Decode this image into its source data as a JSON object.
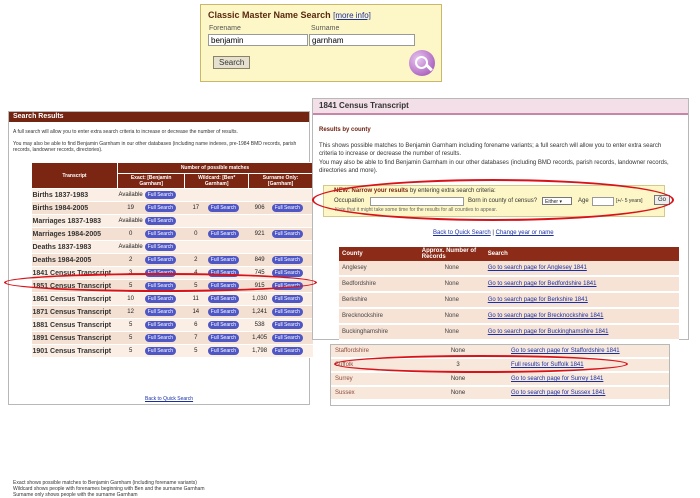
{
  "master_search": {
    "title": "Classic Master Name Search",
    "more_info": "[more info]",
    "forename_label": "Forename",
    "surname_label": "Surname",
    "forename_value": "benjamin",
    "surname_value": "garnham",
    "search_button": "Search"
  },
  "search_results": {
    "header": "Search Results",
    "intro": "A full search will allow you to enter extra search criteria to increase or decrease the number of results.",
    "also": "You may also be able to find Benjamin Garnham in our other databases (including name indexes, pre-1984 BMD records, parish records, landowner records, directories).",
    "col_transcript": "Transcript",
    "col_matches": "Number of possible matches",
    "col_exact": "Exact: [Benjamin Garnham]",
    "col_wildcard": "Wildcard: [Ben* Garnham]",
    "col_surname": "Surname Only: [Garnham]",
    "full_search": "Full Search",
    "rows": [
      {
        "name": "Births 1837-1983",
        "exact": "Available",
        "wild": "",
        "sur": ""
      },
      {
        "name": "Births 1984-2005",
        "exact": "19",
        "wild": "17",
        "sur": "906"
      },
      {
        "name": "Marriages 1837-1983",
        "exact": "Available",
        "wild": "",
        "sur": ""
      },
      {
        "name": "Marriages 1984-2005",
        "exact": "0",
        "wild": "0",
        "sur": "921"
      },
      {
        "name": "Deaths 1837-1983",
        "exact": "Available",
        "wild": "",
        "sur": ""
      },
      {
        "name": "Deaths 1984-2005",
        "exact": "2",
        "wild": "2",
        "sur": "849"
      },
      {
        "name": "1841 Census Transcript",
        "exact": "3",
        "wild": "4",
        "sur": "745"
      },
      {
        "name": "1851 Census Transcript",
        "exact": "5",
        "wild": "5",
        "sur": "915"
      },
      {
        "name": "1861 Census Transcript",
        "exact": "10",
        "wild": "11",
        "sur": "1,030"
      },
      {
        "name": "1871 Census Transcript",
        "exact": "12",
        "wild": "14",
        "sur": "1,241"
      },
      {
        "name": "1881 Census Transcript",
        "exact": "5",
        "wild": "6",
        "sur": "538"
      },
      {
        "name": "1891 Census Transcript",
        "exact": "5",
        "wild": "7",
        "sur": "1,405"
      },
      {
        "name": "1901 Census Transcript",
        "exact": "5",
        "wild": "5",
        "sur": "1,798"
      }
    ],
    "note1": "Exact shows possible matches to Benjamin Garnham (including forename variants)",
    "note2": "Wildcard shows people with forenames beginning with Ben and the surname Garnham",
    "note3": "Surname only shows people with the surname Garnham",
    "back_link": "Back to Quick Search"
  },
  "census": {
    "title": "1841 Census Transcript",
    "subtitle": "Results by county",
    "para1": "This shows possible matches to Benjamin Garnham including forename variants; a full search will allow you to enter extra search criteria to increase or decrease the number of results.",
    "para2": "You may also be able to find Benjamin Garnham in our other databases (including BMD records, parish records, landowner records, directories and more).",
    "narrow_title": "NEW: Narrow your results",
    "narrow_rest": "by entering extra search criteria:",
    "occupation_label": "Occupation",
    "born_label": "Born in county of census?",
    "born_value": "Either",
    "age_label": "Age",
    "age_hint": "[+/- 5 years]",
    "go": "Go",
    "note": "Note that it might take some time for the results for all counties to appear.",
    "back_link": "Back to Quick Search",
    "change_link": "Change year or name",
    "col_county": "County",
    "col_records": "Approx. Number of Records",
    "col_search": "Search",
    "rows": [
      {
        "county": "Anglesey",
        "count": "None",
        "link": "Go to search page for Anglesey 1841"
      },
      {
        "county": "Bedfordshire",
        "count": "None",
        "link": "Go to search page for Bedfordshire 1841"
      },
      {
        "county": "Berkshire",
        "count": "None",
        "link": "Go to search page for Berkshire 1841"
      },
      {
        "county": "Brecknockshire",
        "count": "None",
        "link": "Go to search page for Brecknockshire 1841"
      },
      {
        "county": "Buckinghamshire",
        "count": "None",
        "link": "Go to search page for Buckinghamshire 1841"
      }
    ]
  },
  "snippet": {
    "rows": [
      {
        "county": "Staffordshire",
        "count": "None",
        "link": "Go to search page for Staffordshire 1841"
      },
      {
        "county": "Suffolk",
        "count": "3",
        "link": "Full results for Suffolk 1841"
      },
      {
        "county": "Surrey",
        "count": "None",
        "link": "Go to search page for Surrey 1841"
      },
      {
        "county": "Sussex",
        "count": "None",
        "link": "Go to search page for Sussex 1841"
      }
    ]
  },
  "colors": {
    "highlight": "#d9121a",
    "header_brown": "#742512",
    "button_blue": "#4e57c4"
  }
}
